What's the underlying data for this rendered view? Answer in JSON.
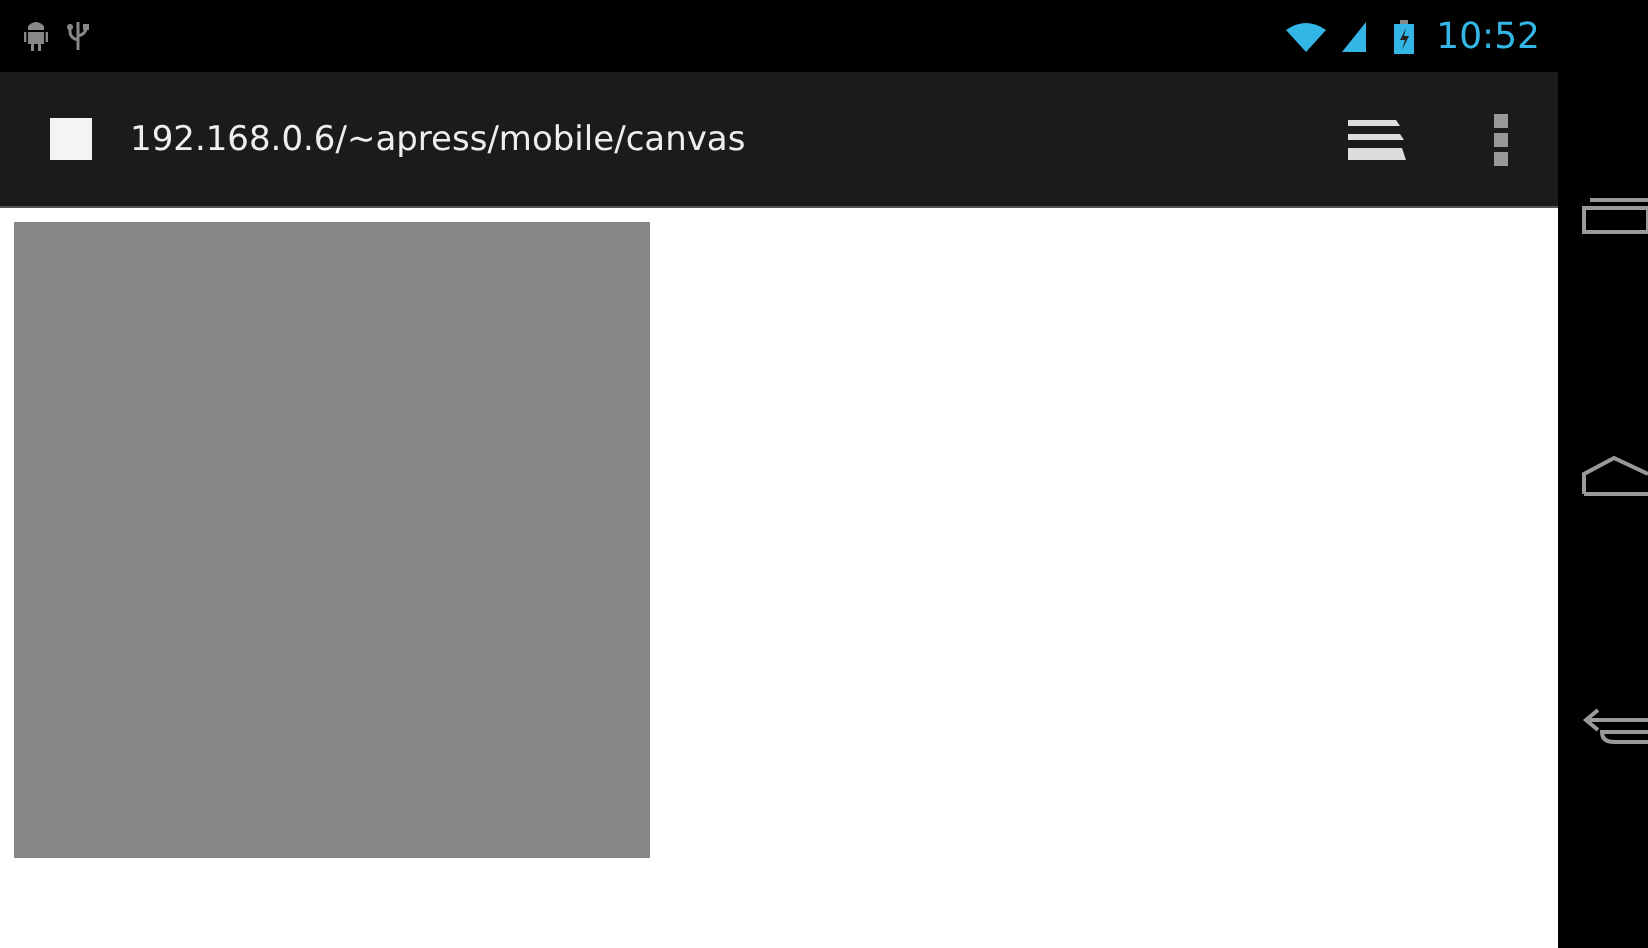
{
  "status_bar": {
    "time": "10:52"
  },
  "address_bar": {
    "url": "192.168.0.6/~apress/mobile/canvas"
  }
}
